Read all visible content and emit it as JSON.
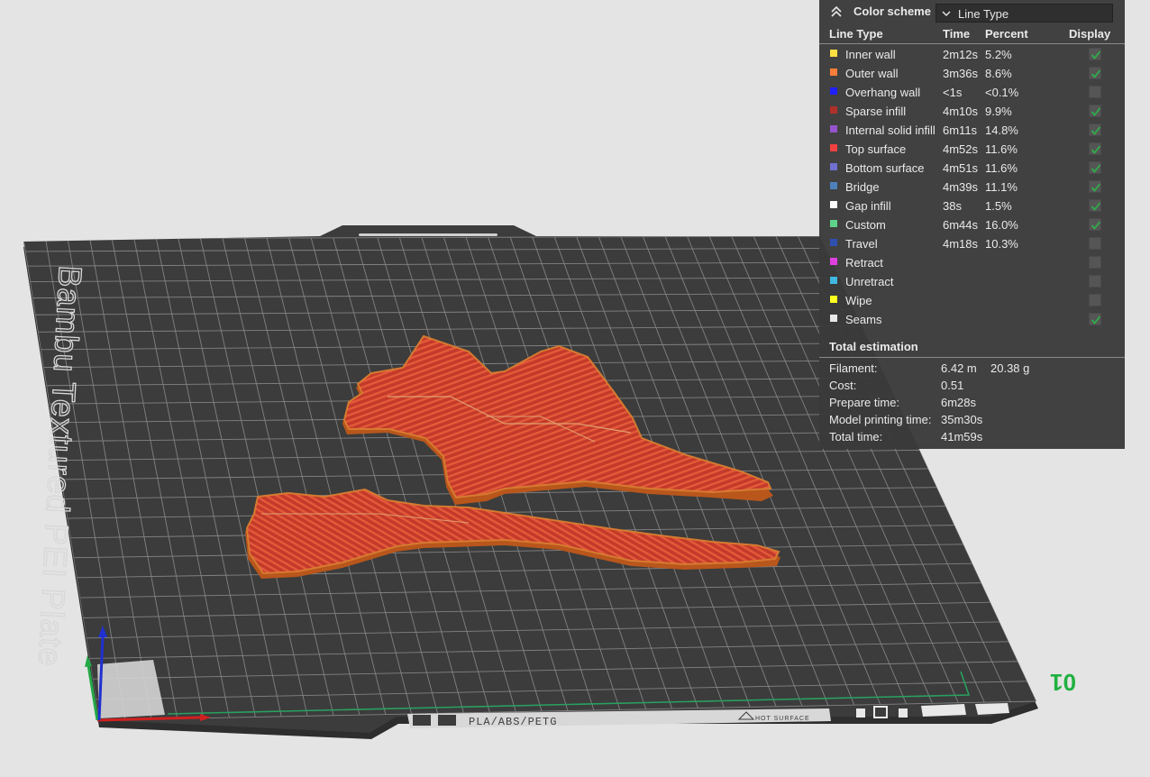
{
  "plate": {
    "brand_text": "Bambu Textured PEI Plate",
    "filament_label": "PLA/ABS/PETG",
    "hot_surface_label": "HOT SURFACE",
    "plate_number": "01"
  },
  "colors": {
    "background": "#e4e4e4",
    "plate": "#3c3c3c",
    "grid": "#9a9a9a",
    "model_red": "#c83a28",
    "model_orange": "#d6731f",
    "axis_x": "#d02020",
    "axis_y": "#24a848",
    "axis_z": "#2030d0",
    "plate_number": "#20b040"
  },
  "legend": {
    "title": "Color scheme",
    "mode": "Line Type",
    "columns": {
      "type": "Line Type",
      "time": "Time",
      "percent": "Percent",
      "display": "Display"
    },
    "rows": [
      {
        "name": "Inner wall",
        "time": "2m12s",
        "percent": "5.2%",
        "color": "#ffe040",
        "display": true
      },
      {
        "name": "Outer wall",
        "time": "3m36s",
        "percent": "8.6%",
        "color": "#ff7d38",
        "display": true
      },
      {
        "name": "Overhang wall",
        "time": "<1s",
        "percent": "<0.1%",
        "color": "#1f1fff",
        "display": false
      },
      {
        "name": "Sparse infill",
        "time": "4m10s",
        "percent": "9.9%",
        "color": "#b03029",
        "display": true
      },
      {
        "name": "Internal solid infill",
        "time": "6m11s",
        "percent": "14.8%",
        "color": "#9654cc",
        "display": true
      },
      {
        "name": "Top surface",
        "time": "4m52s",
        "percent": "11.6%",
        "color": "#f04040",
        "display": true
      },
      {
        "name": "Bottom surface",
        "time": "4m51s",
        "percent": "11.6%",
        "color": "#7070d0",
        "display": true
      },
      {
        "name": "Bridge",
        "time": "4m39s",
        "percent": "11.1%",
        "color": "#4d80ba",
        "display": true
      },
      {
        "name": "Gap infill",
        "time": "38s",
        "percent": "1.5%",
        "color": "#ffffff",
        "display": true
      },
      {
        "name": "Custom",
        "time": "6m44s",
        "percent": "16.0%",
        "color": "#5ed28a",
        "display": true
      },
      {
        "name": "Travel",
        "time": "4m18s",
        "percent": "10.3%",
        "color": "#3050b0",
        "display": false
      },
      {
        "name": "Retract",
        "time": "",
        "percent": "",
        "color": "#e040e0",
        "display": false
      },
      {
        "name": "Unretract",
        "time": "",
        "percent": "",
        "color": "#40b8e0",
        "display": false
      },
      {
        "name": "Wipe",
        "time": "",
        "percent": "",
        "color": "#ffff20",
        "display": false
      },
      {
        "name": "Seams",
        "time": "",
        "percent": "",
        "color": "#e8e8e8",
        "display": true
      }
    ]
  },
  "estimation": {
    "title": "Total estimation",
    "filament": {
      "label": "Filament:",
      "length": "6.42 m",
      "weight": "20.38 g"
    },
    "cost": {
      "label": "Cost:",
      "value": "0.51"
    },
    "prepare_time": {
      "label": "Prepare time:",
      "value": "6m28s"
    },
    "model_time": {
      "label": "Model printing time:",
      "value": "35m30s"
    },
    "total_time": {
      "label": "Total time:",
      "value": "41m59s"
    }
  }
}
